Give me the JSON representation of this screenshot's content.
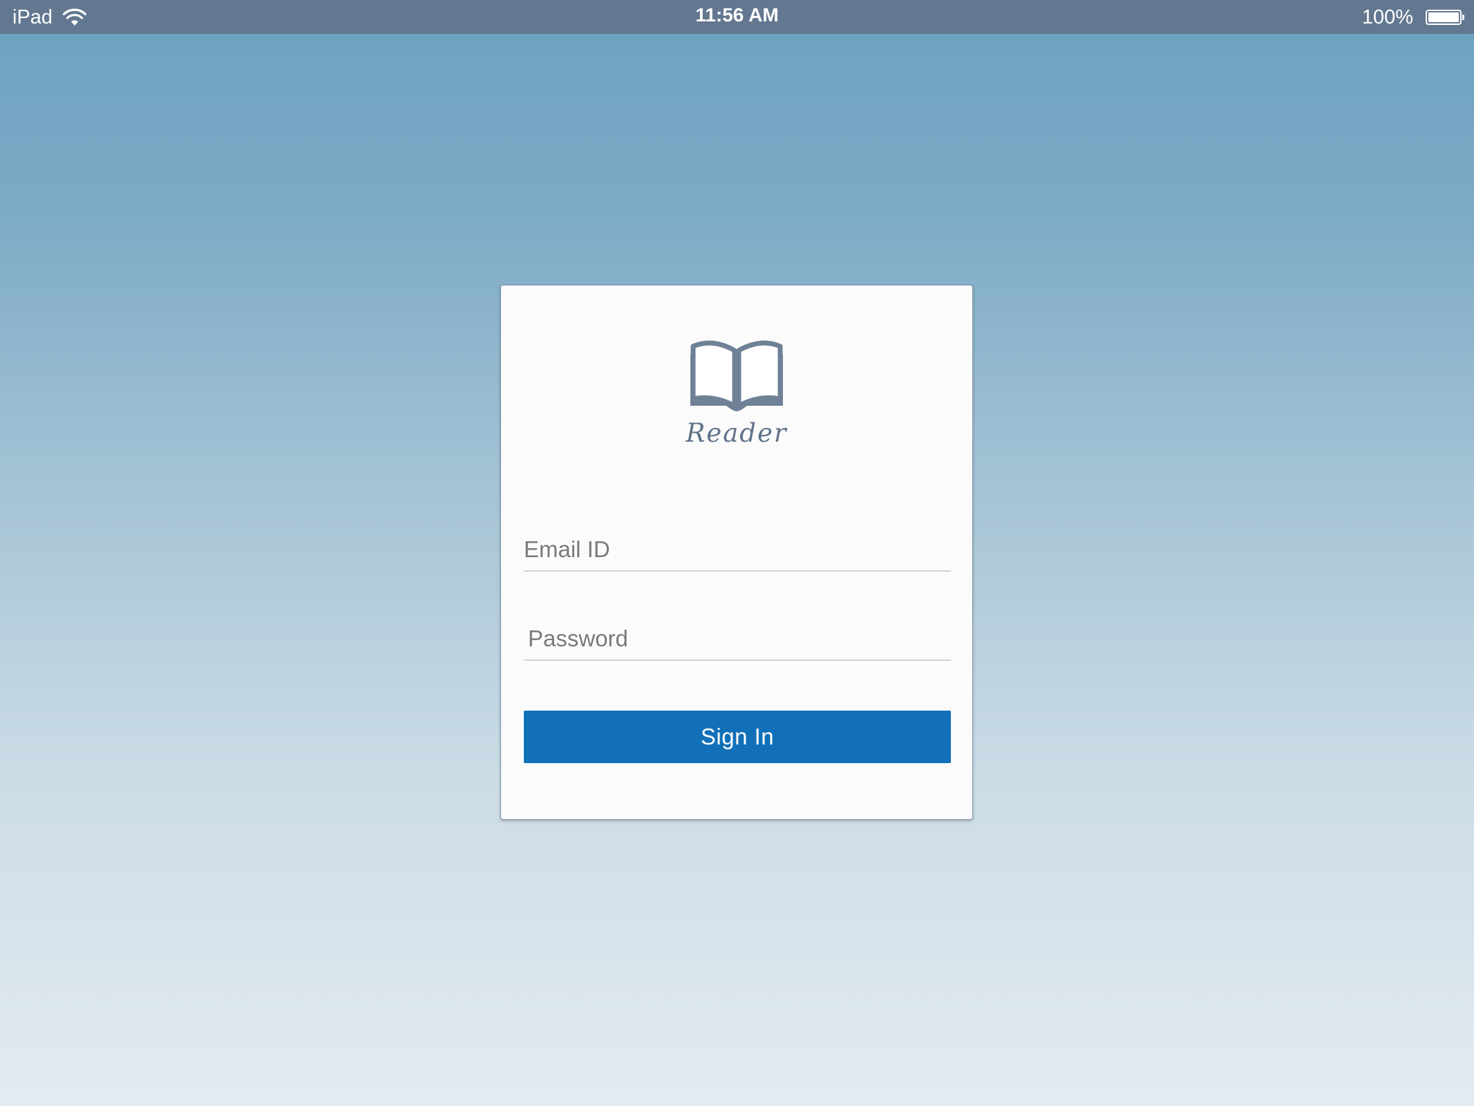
{
  "status_bar": {
    "device": "iPad",
    "time": "11:56 AM",
    "battery_percent": "100%",
    "battery_level": 1.0,
    "icons": [
      "wifi-icon",
      "battery-icon"
    ]
  },
  "login": {
    "logo_icon": "open-book-icon",
    "logo_text": "Reader",
    "email_placeholder": "Email ID",
    "email_value": "",
    "password_placeholder": "Password",
    "password_value": "",
    "sign_in_label": "Sign In"
  },
  "colors": {
    "status_bar": "#637890",
    "accent_button": "#1270b8",
    "logo": "#6f8196"
  }
}
